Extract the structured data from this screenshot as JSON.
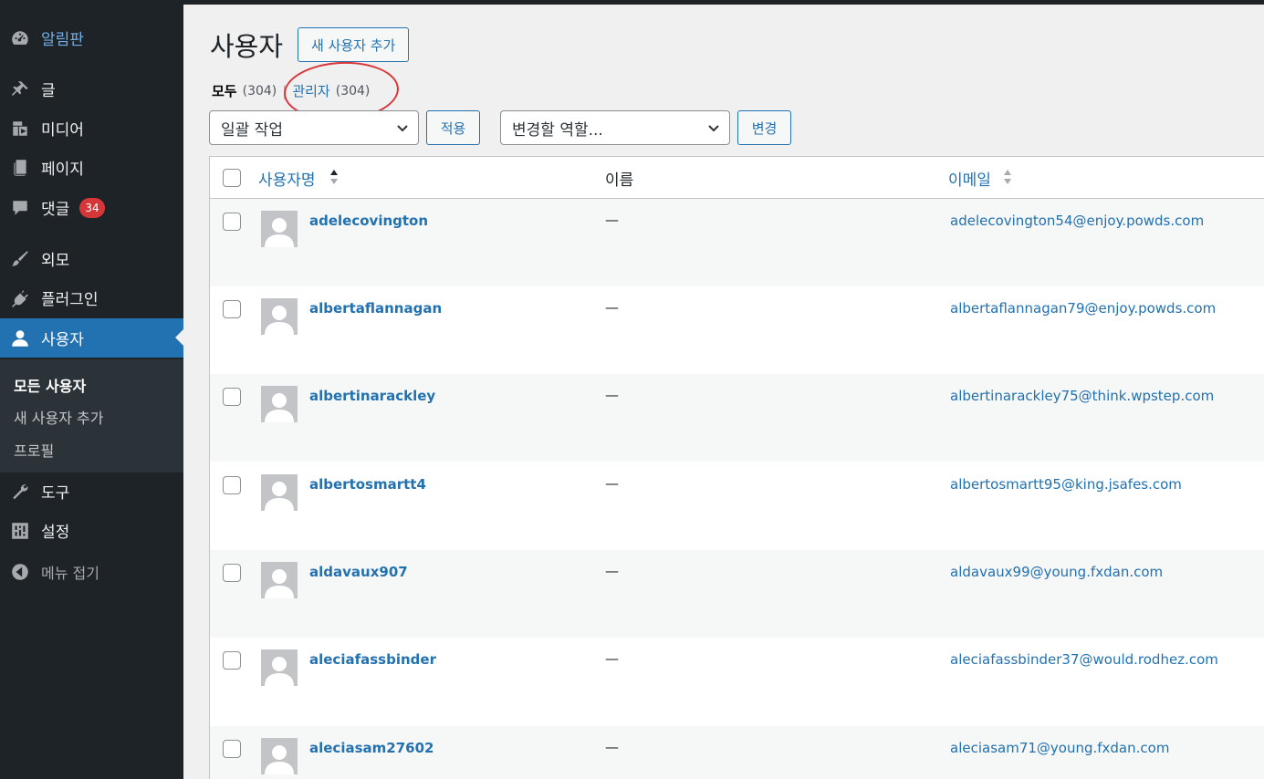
{
  "sidebar": {
    "items": [
      {
        "key": "dashboard",
        "label": "알림판",
        "icon": "dashboard-icon"
      },
      {
        "key": "posts",
        "label": "글",
        "icon": "pin-icon"
      },
      {
        "key": "media",
        "label": "미디어",
        "icon": "media-icon"
      },
      {
        "key": "pages",
        "label": "페이지",
        "icon": "page-icon"
      },
      {
        "key": "comments",
        "label": "댓글",
        "icon": "comment-icon",
        "badge": "34"
      },
      {
        "key": "appearance",
        "label": "외모",
        "icon": "brush-icon"
      },
      {
        "key": "plugins",
        "label": "플러그인",
        "icon": "plugin-icon"
      },
      {
        "key": "users",
        "label": "사용자",
        "icon": "user-icon"
      },
      {
        "key": "tools",
        "label": "도구",
        "icon": "wrench-icon"
      },
      {
        "key": "settings",
        "label": "설정",
        "icon": "settings-icon"
      },
      {
        "key": "collapse",
        "label": "메뉴 접기",
        "icon": "collapse-icon"
      }
    ],
    "submenu": [
      "모든 사용자",
      "새 사용자 추가",
      "프로필"
    ]
  },
  "header": {
    "title": "사용자",
    "add_new": "새 사용자 추가"
  },
  "filters": {
    "all_label": "모두",
    "all_count": "(304)",
    "separator": "|",
    "admin_label": "관리자",
    "admin_count": "(304)"
  },
  "bulk": {
    "action_value": "일괄 작업",
    "apply": "적용",
    "role_value": "변경할 역할...",
    "change": "변경"
  },
  "table": {
    "columns": {
      "username": "사용자명",
      "name": "이름",
      "email": "이메일"
    },
    "rows": [
      {
        "username": "adelecovington",
        "name": "—",
        "email": "adelecovington54@enjoy.powds.com"
      },
      {
        "username": "albertaflannagan",
        "name": "—",
        "email": "albertaflannagan79@enjoy.powds.com"
      },
      {
        "username": "albertinarackley",
        "name": "—",
        "email": "albertinarackley75@think.wpstep.com"
      },
      {
        "username": "albertosmartt4",
        "name": "—",
        "email": "albertosmartt95@king.jsafes.com"
      },
      {
        "username": "aldavaux907",
        "name": "—",
        "email": "aldavaux99@young.fxdan.com"
      },
      {
        "username": "aleciafassbinder",
        "name": "—",
        "email": "aleciafassbinder37@would.rodhez.com"
      },
      {
        "username": "aleciasam27602",
        "name": "—",
        "email": "aleciasam71@young.fxdan.com"
      }
    ]
  },
  "colors": {
    "sidebar_bg": "#1d2327",
    "accent": "#2271b1",
    "badge": "#d63638",
    "annotation_circle": "#d9363a"
  }
}
